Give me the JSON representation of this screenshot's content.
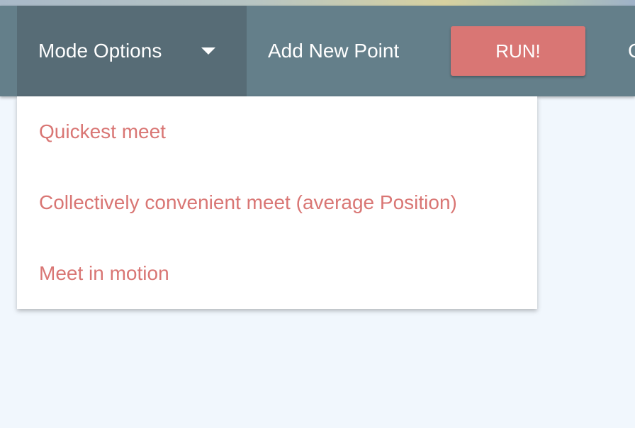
{
  "navbar": {
    "mode_options_label": "Mode Options",
    "add_point_label": "Add New Point",
    "run_label": "RUN!",
    "partial_item_label": "C"
  },
  "dropdown": {
    "items": [
      {
        "label": "Quickest meet"
      },
      {
        "label": "Collectively convenient meet (average Position)"
      },
      {
        "label": "Meet in motion"
      }
    ]
  },
  "colors": {
    "navbar_bg": "#647f8a",
    "active_menu_bg": "#576c76",
    "accent": "#d97674",
    "page_bg": "#f1f7fd"
  },
  "icons": {
    "dropdown_caret": "caret-down-icon"
  }
}
